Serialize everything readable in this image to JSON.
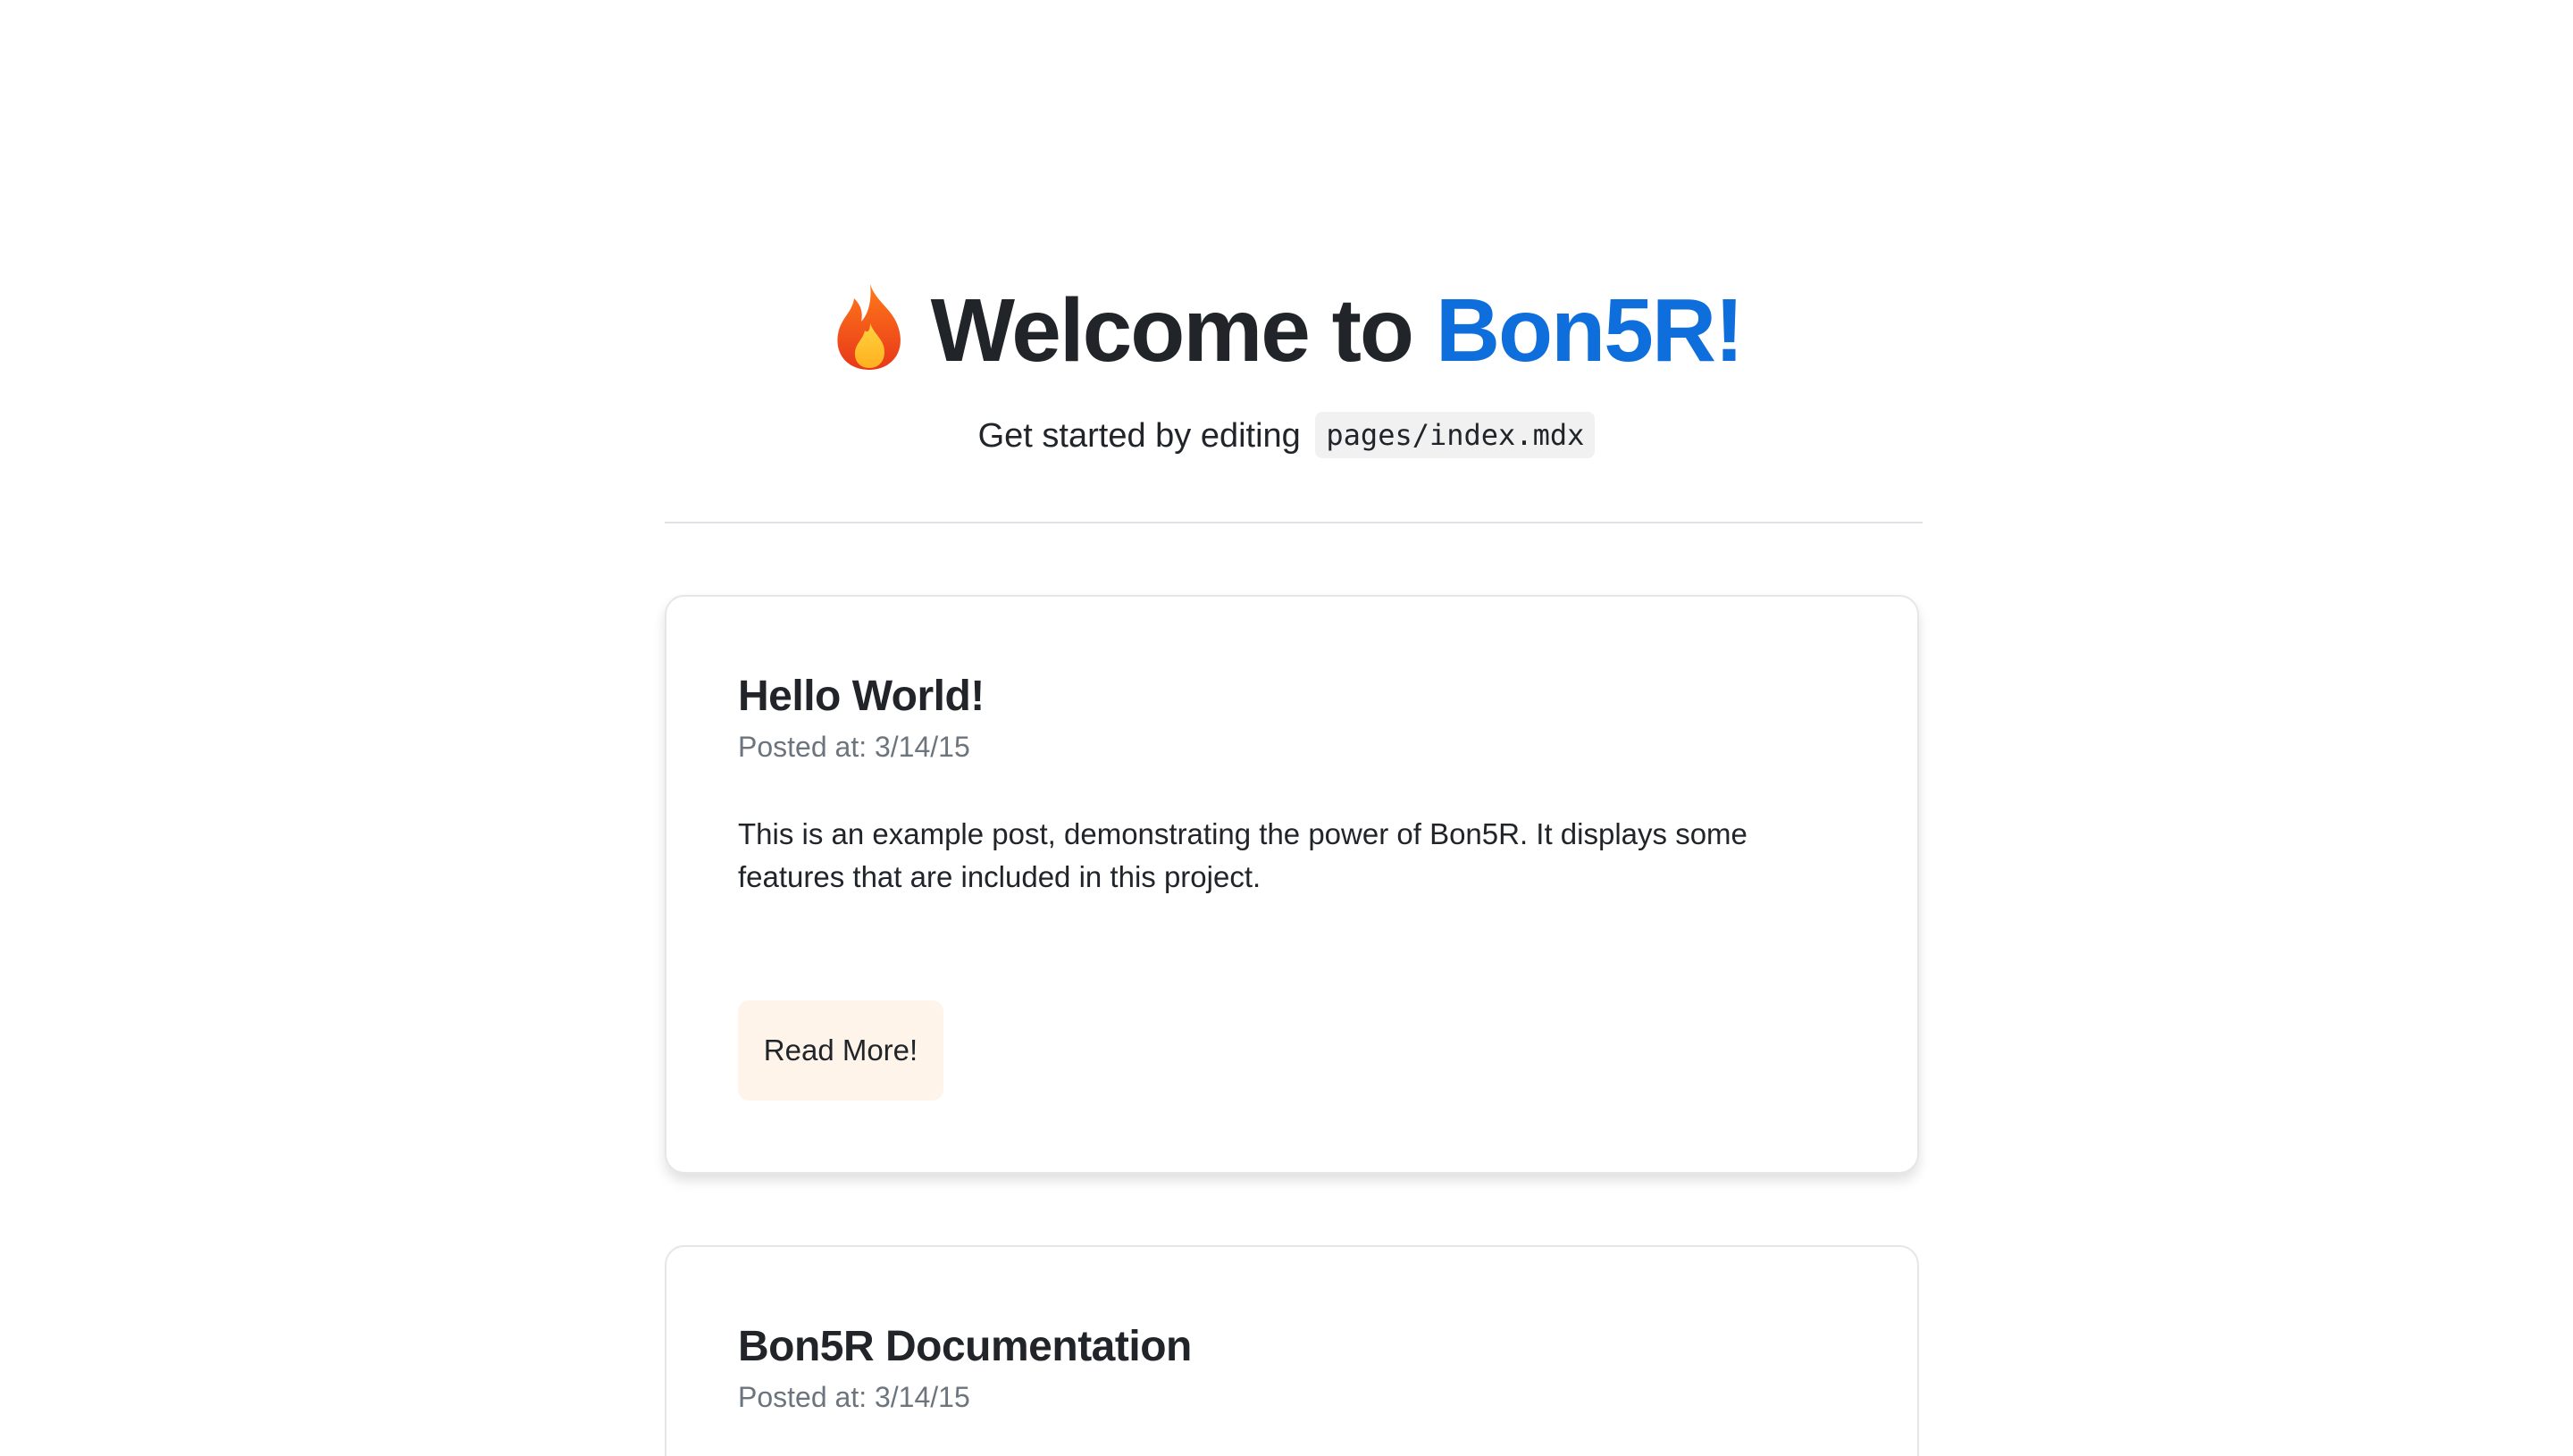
{
  "header": {
    "title_prefix": "Welcome to",
    "title_brand": "Bon5R!",
    "icon": "fire-icon",
    "subtitle": "Get started by editing",
    "code": "pages/index.mdx"
  },
  "colors": {
    "brand": "#0d6edc",
    "button_bg": "#fff4ea",
    "muted_text": "#6c757d"
  },
  "posts": [
    {
      "title": "Hello World!",
      "date": "Posted at: 3/14/15",
      "excerpt": "This is an example post, demonstrating the power of Bon5R. It displays some features that are included in this project.",
      "button_label": "Read More!"
    },
    {
      "title": "Bon5R Documentation",
      "date": "Posted at: 3/14/15"
    }
  ]
}
